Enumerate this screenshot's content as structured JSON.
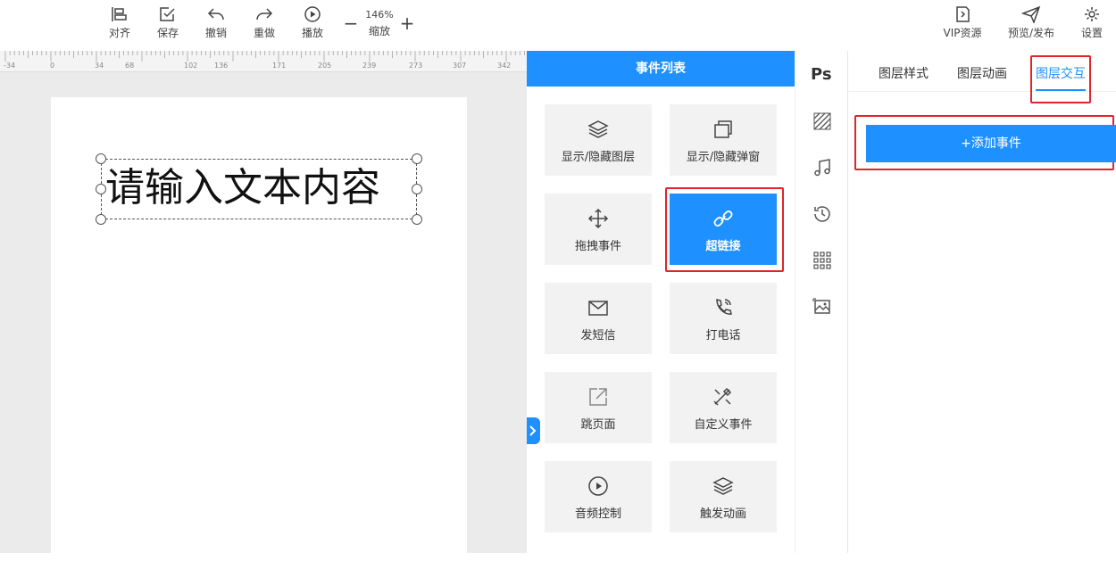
{
  "toolbar": {
    "left": [
      {
        "name": "align-button",
        "icon": "align-icon",
        "label": "对齐"
      },
      {
        "name": "save-button",
        "icon": "save-icon",
        "label": "保存"
      },
      {
        "name": "undo-button",
        "icon": "undo-icon",
        "label": "撤销"
      },
      {
        "name": "redo-button",
        "icon": "redo-icon",
        "label": "重做"
      },
      {
        "name": "play-button",
        "icon": "play-icon",
        "label": "播放"
      }
    ],
    "zoom": {
      "minus": "−",
      "value": "146%",
      "label": "缩放",
      "plus": "+"
    },
    "right": [
      {
        "name": "vip-resources-button",
        "icon": "vip-icon",
        "label": "VIP资源"
      },
      {
        "name": "preview-publish-button",
        "icon": "send-icon",
        "label": "预览/发布"
      },
      {
        "name": "settings-button",
        "icon": "gear-icon",
        "label": "设置"
      }
    ]
  },
  "ruler": {
    "ticks": [
      "-34",
      "0",
      "34",
      "68",
      "102",
      "136",
      "171",
      "205",
      "239",
      "273",
      "307",
      "342"
    ]
  },
  "canvas": {
    "text_layer": "请输入文本内容"
  },
  "events_panel": {
    "title": "事件列表",
    "items": [
      {
        "name": "show-hide-layer",
        "icon": "layers-icon",
        "label": "显示/隐藏图层"
      },
      {
        "name": "show-hide-popup",
        "icon": "windows-icon",
        "label": "显示/隐藏弹窗"
      },
      {
        "name": "drag-event",
        "icon": "move-icon",
        "label": "拖拽事件"
      },
      {
        "name": "hyperlink",
        "icon": "link-icon",
        "label": "超链接",
        "active": true
      },
      {
        "name": "send-sms",
        "icon": "mail-icon",
        "label": "发短信"
      },
      {
        "name": "phone-call",
        "icon": "phone-icon",
        "label": "打电话"
      },
      {
        "name": "jump-page",
        "icon": "external-link-icon",
        "label": "跳页面"
      },
      {
        "name": "custom-event",
        "icon": "tools-icon",
        "label": "自定义事件"
      },
      {
        "name": "audio-control",
        "icon": "play-circle-icon",
        "label": "音频控制"
      },
      {
        "name": "trigger-animation",
        "icon": "layers-icon",
        "label": "触发动画"
      }
    ]
  },
  "side_strip": {
    "ps_label": "Ps",
    "icons": [
      "texture-icon",
      "music-icon",
      "history-icon",
      "grid-icon",
      "image-icon"
    ]
  },
  "props_panel": {
    "tabs": [
      {
        "label": "图层样式"
      },
      {
        "label": "图层动画"
      },
      {
        "label": "图层交互",
        "active": true
      }
    ],
    "add_event_label": "+添加事件"
  },
  "colors": {
    "accent": "#1e90ff",
    "highlight": "#e0242a",
    "canvas_bg": "#ebebeb"
  }
}
